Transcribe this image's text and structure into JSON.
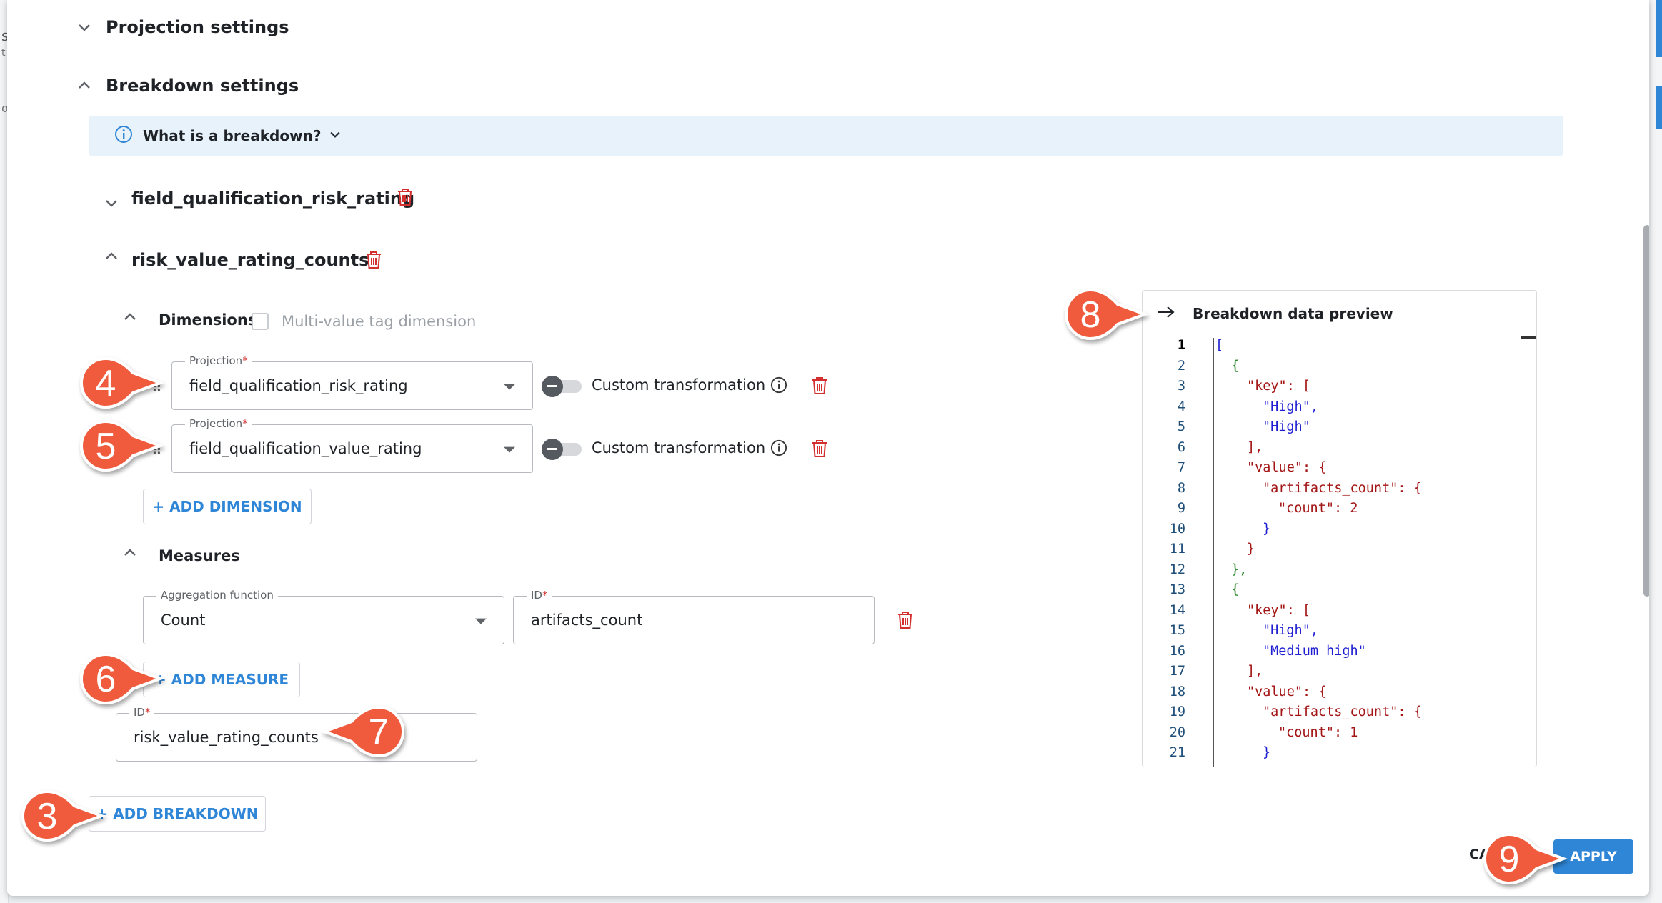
{
  "background": {
    "left_fragments": [
      "s",
      "t",
      "o"
    ]
  },
  "sections": {
    "projection": {
      "title": "Projection settings"
    },
    "breakdown": {
      "title": "Breakdown settings"
    }
  },
  "info_banner": {
    "text": "What is a breakdown?"
  },
  "breakdowns": [
    {
      "name": "field_qualification_risk_rating",
      "expanded": false
    },
    {
      "name": "risk_value_rating_counts",
      "expanded": true
    }
  ],
  "dimensions": {
    "title": "Dimensions",
    "multi_value_label": "Multi-value tag dimension",
    "rows": [
      {
        "label": "Projection",
        "value": "field_qualification_risk_rating",
        "toggle_label": "Custom transformation"
      },
      {
        "label": "Projection",
        "value": "field_qualification_value_rating",
        "toggle_label": "Custom transformation"
      }
    ],
    "add_label": "+ ADD DIMENSION"
  },
  "measures": {
    "title": "Measures",
    "aggregation_label": "Aggregation function",
    "aggregation_value": "Count",
    "id_label": "ID",
    "id_value": "artifacts_count",
    "add_label": "+ ADD MEASURE"
  },
  "breakdown_id": {
    "label": "ID",
    "value": "risk_value_rating_counts"
  },
  "add_breakdown_label": "+ ADD BREAKDOWN",
  "preview": {
    "title": "Breakdown data preview",
    "line_numbers": [
      "1",
      "2",
      "3",
      "4",
      "5",
      "6",
      "7",
      "8",
      "9",
      "10",
      "11",
      "12",
      "13",
      "14",
      "15",
      "16",
      "17",
      "18",
      "19",
      "20",
      "21"
    ],
    "code": [
      "[",
      "{",
      "\"key\": [",
      "\"High\",",
      "\"High\"",
      "],",
      "\"value\": {",
      "\"artifacts_count\": {",
      "\"count\": 2",
      "}",
      "}",
      "},",
      "{",
      "\"key\": [",
      "\"High\",",
      "\"Medium high\"",
      "],",
      "\"value\": {",
      "\"artifacts_count\": {",
      "\"count\": 1",
      "}"
    ]
  },
  "footer": {
    "cancel_label": "CA",
    "apply_label": "APPLY"
  },
  "callouts": [
    "3",
    "4",
    "5",
    "6",
    "7",
    "8",
    "9"
  ],
  "colors": {
    "accent": "#2f86d6",
    "danger": "#d32f2f",
    "callout": "#f05a3c",
    "banner": "#e8f2fb"
  },
  "icons": [
    "chevron-down-icon",
    "chevron-up-icon",
    "info-icon",
    "trash-icon",
    "arrow-right-icon",
    "drag-handle-icon"
  ]
}
